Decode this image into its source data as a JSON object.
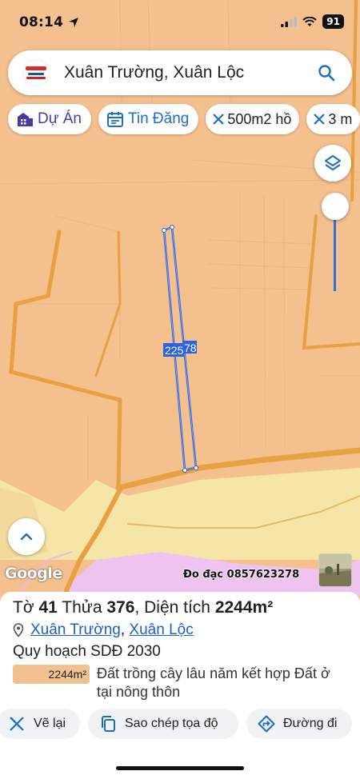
{
  "status_bar": {
    "time": "08:14",
    "battery": "91"
  },
  "search": {
    "query": "Xuân Trường, Xuân Lộc"
  },
  "chips": [
    {
      "label": "Dự Án",
      "icon": "building-icon"
    },
    {
      "label": "Tin Đăng",
      "icon": "calendar-icon"
    },
    {
      "label": "500m2 hồ",
      "icon": "ruler-icon"
    },
    {
      "label": "3 m",
      "icon": "ruler-icon"
    }
  ],
  "map": {
    "parcel_label": "225",
    "parcel_label_2": "78",
    "attribution": "Google",
    "survey_contact": "Đo đạc 0857623278",
    "colors": {
      "land": "#f3c08e",
      "road": "#e8a042",
      "residential": "#f5e6a8",
      "pink_zone": "#efc3ef",
      "parcel_outline": "#2a62e0"
    }
  },
  "info": {
    "sheet_label": "Tờ",
    "sheet_no": "41",
    "plot_label": "Thửa",
    "plot_no": "376",
    "area_label": "Diện tích",
    "area_value": "2244m²",
    "commune": "Xuân Trường",
    "district": "Xuân Lộc",
    "separator": ",",
    "plan_title": "Quy hoạch SDĐ 2030",
    "legend_area": "2244m²",
    "legend_text": "Đất trồng cây lâu năm kết hợp Đất ở tại nông thôn"
  },
  "actions": [
    {
      "label": "Vẽ lại",
      "icon": "draw-icon"
    },
    {
      "label": "Sao chép tọa độ",
      "icon": "copy-icon"
    },
    {
      "label": "Đường đi",
      "icon": "directions-icon"
    }
  ]
}
